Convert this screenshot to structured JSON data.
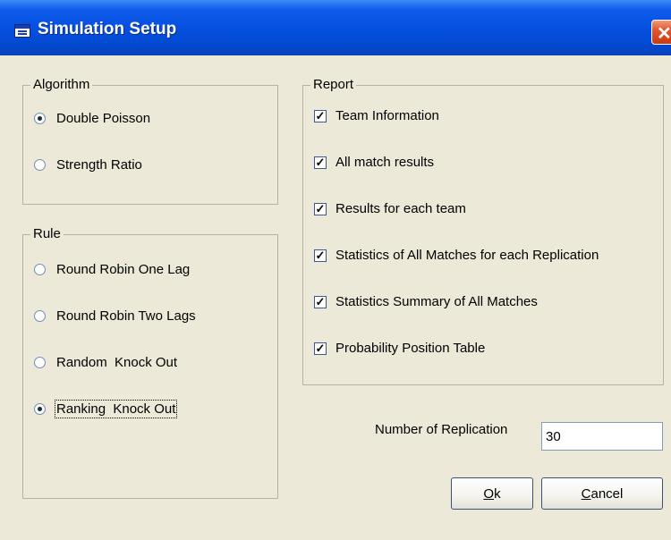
{
  "window": {
    "title": "Simulation Setup",
    "close_glyph": "✕"
  },
  "algorithm": {
    "legend": "Algorithm",
    "options": [
      {
        "label": "Double Poisson",
        "selected": true
      },
      {
        "label": "Strength Ratio",
        "selected": false
      }
    ]
  },
  "rule": {
    "legend": "Rule",
    "options": [
      {
        "label": "Round Robin One Lag",
        "selected": false
      },
      {
        "label": "Round Robin Two Lags",
        "selected": false
      },
      {
        "label": "Random  Knock Out",
        "selected": false
      },
      {
        "label": "Ranking  Knock Out",
        "selected": true
      }
    ]
  },
  "report": {
    "legend": "Report",
    "items": [
      {
        "label": "Team Information",
        "checked": true
      },
      {
        "label": "All match results",
        "checked": true
      },
      {
        "label": "Results for each team",
        "checked": true
      },
      {
        "label": "Statistics of All Matches for each Replication",
        "checked": true
      },
      {
        "label": "Statistics Summary of All Matches",
        "checked": true
      },
      {
        "label": "Probability Position Table",
        "checked": true
      }
    ],
    "check_glyph": "✓"
  },
  "replication": {
    "label": "Number of Replication",
    "value": "30"
  },
  "buttons": {
    "ok_mnemonic": "O",
    "ok_rest": "k",
    "cancel_mnemonic": "C",
    "cancel_rest": "ancel"
  }
}
